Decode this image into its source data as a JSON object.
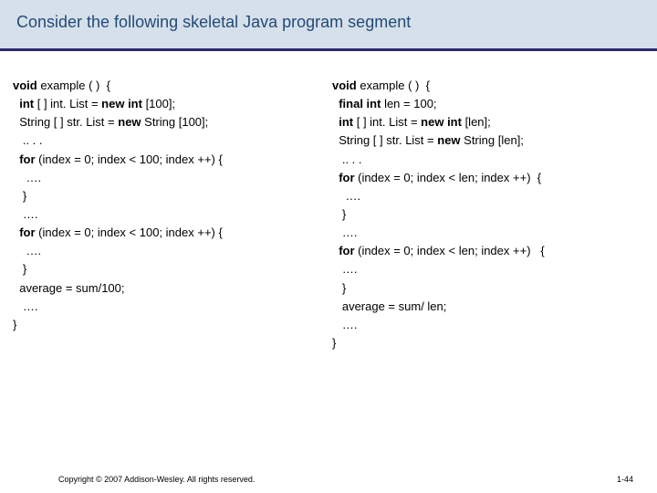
{
  "title": "Consider the following skeletal Java program segment",
  "left": {
    "l1a": "void",
    "l1b": " example ( )  {",
    "l2a": "  int",
    "l2b": " [ ] int. List = ",
    "l2c": "new int",
    "l2d": " [100];",
    "l3a": "  String [ ] str. List = ",
    "l3b": "new",
    "l3c": " String [100];",
    "l4": "   .. . .",
    "l5a": "  for",
    "l5b": " (index = 0; index < 100; index ++) {",
    "l6": "    …. ",
    "l7": "   }",
    "l8": "   …. ",
    "l9a": "  for",
    "l9b": " (index = 0; index < 100; index ++) {",
    "l10": "    …. ",
    "l11": "   }",
    "l12": "  average = sum/100;",
    "l13": "   …. ",
    "l14": "}"
  },
  "right": {
    "l1a": "void",
    "l1b": " example ( )  {",
    "l2a": "  final int",
    "l2b": " len = 100;",
    "l3a": "  int",
    "l3b": " [ ] int. List = ",
    "l3c": "new int",
    "l3d": " [len];",
    "l4a": "  String [ ] str. List = ",
    "l4b": "new",
    "l4c": " String [len];",
    "l5": "   .. . .",
    "l6a": "  for",
    "l6b": " (index = 0; index < len; index ++)  {",
    "l7": "    …. ",
    "l8": "   }",
    "l9": "   …. ",
    "l10a": "  for",
    "l10b": " (index = 0; index < len; index ++)   {",
    "l11": "   …. ",
    "l12": "   }",
    "l13": "   average = sum/ len;",
    "l14": "   …. ",
    "l15": "}"
  },
  "footer": {
    "copyright": "Copyright © 2007 Addison-Wesley. All rights reserved.",
    "page": "1-44"
  }
}
